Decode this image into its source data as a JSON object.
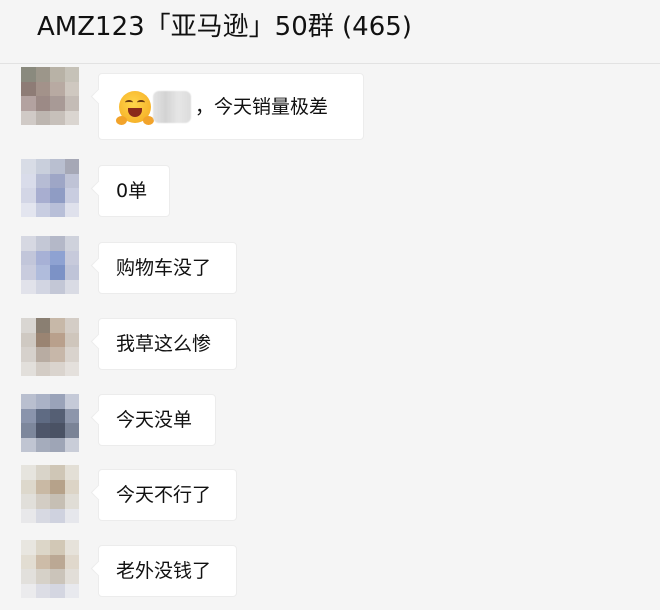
{
  "chat": {
    "title": "AMZ123「亚马逊」50群 (465)"
  },
  "messages": [
    {
      "text": "，今天销量极差",
      "emoji": "laughing-with-hands-emoji",
      "mention": "blurred-mention",
      "avatar_colors": [
        "#8a8a7e",
        "#9c968a",
        "#b8b2a6",
        "#c6c2b8",
        "#8e7c76",
        "#a3928a",
        "#b8aaa2",
        "#cfc8c0",
        "#b3a2a0",
        "#9c8a86",
        "#a89a96",
        "#c4bcb6",
        "#d0cac6",
        "#bdb6b0",
        "#c7c0ba",
        "#dad5d0"
      ]
    },
    {
      "text": "0单",
      "avatar_colors": [
        "#d8dce6",
        "#c9cfdc",
        "#b9bfd0",
        "#a6a8b6",
        "#d9dcea",
        "#b6bcd4",
        "#9ea6c6",
        "#bfc3d6",
        "#d3d6e6",
        "#a8aed0",
        "#8f9cc4",
        "#c9cde0",
        "#e3e5ef",
        "#c8cde1",
        "#b8bfd8",
        "#dfe1ec"
      ]
    },
    {
      "text": "购物车没了",
      "avatar_colors": [
        "#d6d8e2",
        "#c4c8d6",
        "#b4b8c8",
        "#cfd2dc",
        "#c2c6da",
        "#a7b1d6",
        "#8ea2d2",
        "#c7cadb",
        "#c9ccde",
        "#b0bcdc",
        "#7c92c6",
        "#bfc4d8",
        "#e1e2ea",
        "#d2d5e2",
        "#c3c7d6",
        "#d9dbe4"
      ]
    },
    {
      "text": "我草这么惨",
      "avatar_colors": [
        "#d9d6d2",
        "#8a7f72",
        "#c7b8a8",
        "#d4cdc6",
        "#cfc9c2",
        "#9a8472",
        "#b9a08c",
        "#cfc6bc",
        "#d6d1cc",
        "#b8aca2",
        "#c7b7a9",
        "#d9d3cd",
        "#e2dfdb",
        "#d3ccc5",
        "#dad4ce",
        "#e4e0dc"
      ]
    },
    {
      "text": "今天没单",
      "avatar_colors": [
        "#b9bfcf",
        "#aab2c6",
        "#9aa3b9",
        "#c5cad8",
        "#8a94ac",
        "#5f6b83",
        "#555f74",
        "#8d96ab",
        "#7d879c",
        "#4e566a",
        "#4a5264",
        "#7a8396",
        "#c0c5d2",
        "#a5acbc",
        "#9ea5b6",
        "#c9cdd8"
      ]
    },
    {
      "text": "今天不行了",
      "avatar_colors": [
        "#e6e4de",
        "#d9d4c9",
        "#cfc6b6",
        "#e3dfd6",
        "#ddd8cc",
        "#c9b9a4",
        "#b6a28a",
        "#dcd4c6",
        "#e1dfda",
        "#d3cdc4",
        "#c6bfb4",
        "#e0ddd6",
        "#e8e8ea",
        "#d7d9e2",
        "#cfd2df",
        "#e6e7ec"
      ]
    },
    {
      "text": "老外没钱了",
      "avatar_colors": [
        "#e8e6e0",
        "#dcd6c8",
        "#d2c8b6",
        "#e6e2da",
        "#e2ddd2",
        "#cdbca8",
        "#bba894",
        "#e0d8cc",
        "#e2e0dc",
        "#d6d1c8",
        "#cbc4ba",
        "#e2ded8",
        "#ebebed",
        "#dcdde5",
        "#d4d6e1",
        "#e8e9ee"
      ]
    }
  ]
}
